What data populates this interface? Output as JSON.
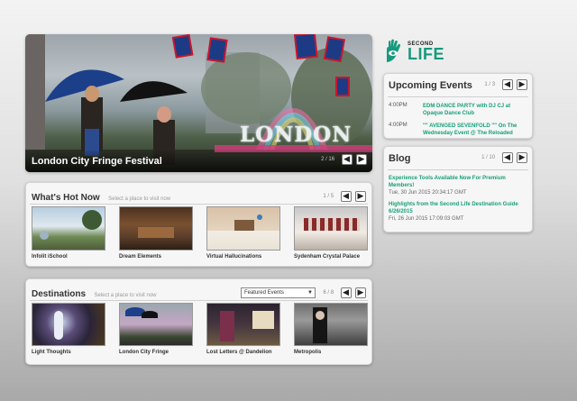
{
  "hero": {
    "caption": "London City Fringe Festival",
    "counter": "2 / 16",
    "sign_text": "LONDON",
    "prev_label": "◀",
    "next_label": "▶"
  },
  "logo": {
    "top": "SECOND",
    "bottom": "LIFE"
  },
  "events": {
    "title": "Upcoming Events",
    "counter": "1 / 3",
    "prev_label": "◀",
    "next_label": "▶",
    "items": [
      {
        "time": "4:00PM",
        "title": "EDM DANCE PARTY with DJ CJ at Opaque Dance Club"
      },
      {
        "time": "4:00PM",
        "title": "\"\" AVENGED SEVENFOLD \"\" On The Wednesday Event @ The Reloaded"
      }
    ]
  },
  "blog": {
    "title": "Blog",
    "counter": "1 / 10",
    "prev_label": "◀",
    "next_label": "▶",
    "items": [
      {
        "title": "Experience Tools Available Now For Premium Members!",
        "date": "Tue, 30 Jun 2015 20:34:17 GMT"
      },
      {
        "title": "Highlights from the Second Life Destination Guide 6/26/2015",
        "date": "Fri, 26 Jun 2015 17:09:03 GMT"
      }
    ]
  },
  "hot": {
    "title": "What's Hot Now",
    "subtitle": "Select a place to visit now",
    "counter": "1 / 5",
    "prev_label": "◀",
    "next_label": "▶",
    "items": [
      {
        "label": "Infolit iSchool"
      },
      {
        "label": "Dream Elements"
      },
      {
        "label": "Virtual Hallucinations"
      },
      {
        "label": "Sydenham Crystal Palace"
      }
    ]
  },
  "destinations": {
    "title": "Destinations",
    "subtitle": "Select a place to visit now",
    "dropdown_value": "Featured Events",
    "counter": "6 / 8",
    "prev_label": "◀",
    "next_label": "▶",
    "items": [
      {
        "label": "Light Thoughts"
      },
      {
        "label": "London City Fringe"
      },
      {
        "label": "Lost Letters @ Dandelion"
      },
      {
        "label": "Metropolis"
      }
    ]
  },
  "colors": {
    "accent_green": "#17a079",
    "panel_bg": "#f6f6f6"
  }
}
